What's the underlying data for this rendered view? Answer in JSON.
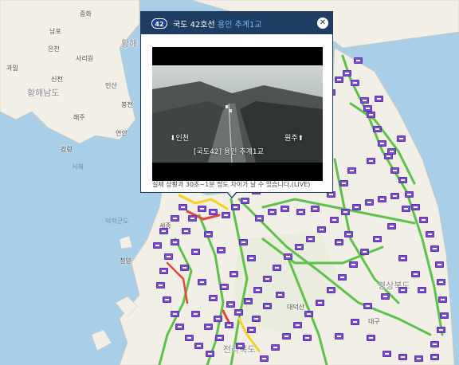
{
  "map": {
    "colors": {
      "sea": "#a9cfe8",
      "land": "#f2efe6",
      "green_road": "#5cc24a",
      "yellow_road": "#f5d21c",
      "red_road": "#e8453c",
      "cctv": "#7b4fd0"
    },
    "labels": {
      "nk1": "중화",
      "nk2": "남포",
      "nk3": "사리원",
      "nk4": "은천",
      "nk5": "과일",
      "nk6": "신천",
      "nk7": "황해남도",
      "nk8": "황해",
      "nk9": "인산",
      "nk10": "봉천",
      "nk11": "연안",
      "nk12": "해주",
      "nk13": "강령",
      "sea1": "덕적군도",
      "sea2": "서해",
      "place1": "세종",
      "place2": "청양",
      "place3": "경상북도",
      "place4": "대구",
      "place5": "전라북도",
      "place6": "대덕산"
    }
  },
  "popup": {
    "route_number": "42",
    "route_name": "국도 42호선",
    "cctv_name": "용인 추계1교",
    "close_label": "✕",
    "video": {
      "dir_left": "⬇인천",
      "dir_right": "원주⬆",
      "caption": "[국도42] 용인 추계1교"
    },
    "notice": "실제 상황과 30초~1분 정도 차이가 날 수 있습니다.(LIVE)"
  }
}
